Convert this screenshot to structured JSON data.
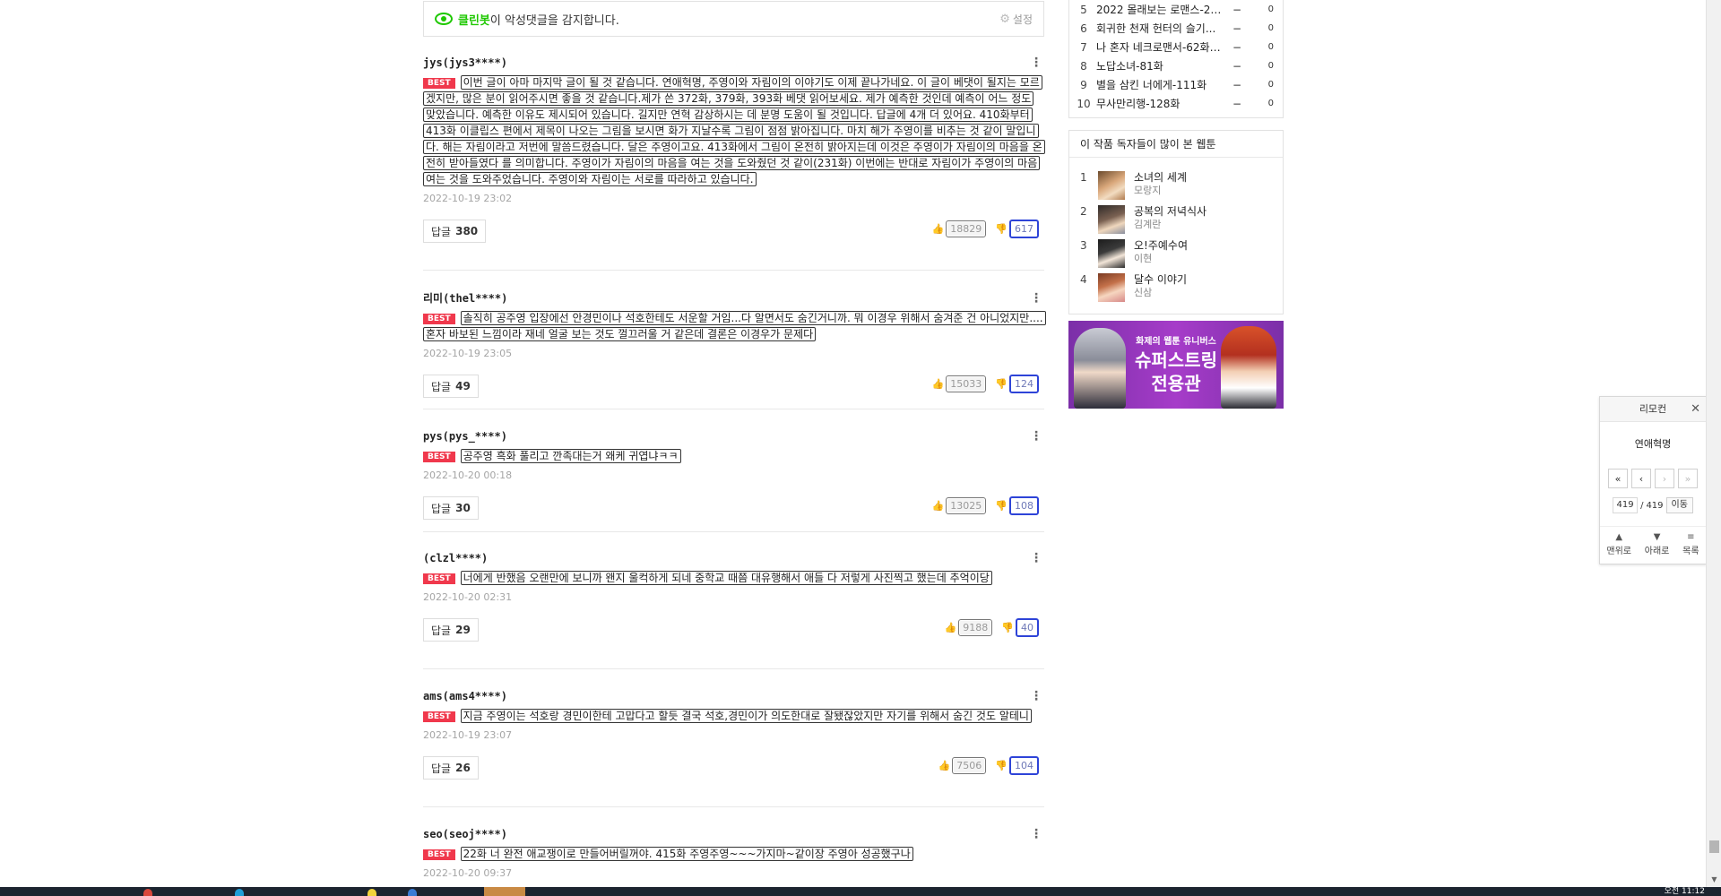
{
  "cleanbot": {
    "brand": "클린봇",
    "message": "이 악성댓글을 감지합니다.",
    "settings_label": "설정"
  },
  "comments": [
    {
      "user": "jys(jys3****)",
      "best_label": "BEST",
      "text": "이번 글이 아마 마지막 글이 될 것 같습니다. 연애혁명, 주영이와 자림이의 이야기도 이제 끝나가네요. 이 글이 베댓이 될지는 모르겠지만, 많은 분이 읽어주시면 좋을 것 같습니다.제가 쓴 372화, 379화, 393화 베댓 읽어보세요. 제가 예측한 것인데 예측이 어느 정도 맞았습니다. 예측한 이유도 제시되어 있습니다. 길지만 연혁 감상하시는 데 분명 도움이 될 것입니다. 답글에 4개 더 있어요. 410화부터 413화 이클립스 편에서 제목이 나오는 그림을 보시면 화가 지날수록 그림이 점점 밝아집니다. 마치 해가 주영이를 비추는 것 같이 말입니다. 해는 자림이라고 저번에 말씀드렸습니다. 달은 주영이고요. 413화에서 그림이 온전히 밝아지는데 이것은 주영이가 자림이의 마음을 온전히 받아들였다 를 의미합니다. 주영이가 자림이의 마음을 여는 것을 도와줬던 것 같이(231화) 이번에는 반대로 자림이가 주영이의 마음 여는 것을 도와주었습니다. 주영이와 자림이는 서로를 따라하고 있습니다.",
      "date": "2022-10-19 23:02",
      "reply_label": "답글",
      "reply_count": "380",
      "likes": "18829",
      "dislikes": "617"
    },
    {
      "user": "리미(thel****)",
      "best_label": "BEST",
      "text": "솔직히 공주영 입장에선 안경민이나 석호한테도 서운할 거임...다 알면서도 숨긴거니까. 뭐 이경우 위해서 숨겨준 건 아니었지만.... 혼자 바보된 느낌이라 재네 얼굴 보는 것도 껄끄러울 거 같은데 결론은 이경우가 문제다",
      "date": "2022-10-19 23:05",
      "reply_label": "답글",
      "reply_count": "49",
      "likes": "15033",
      "dislikes": "124"
    },
    {
      "user": "pys(pys_****)",
      "best_label": "BEST",
      "text": "공주영 흑화 풀리고 깐족대는거 왜케 귀엽냐ㅋㅋ",
      "date": "2022-10-20 00:18",
      "reply_label": "답글",
      "reply_count": "30",
      "likes": "13025",
      "dislikes": "108"
    },
    {
      "user": "(clzl****)",
      "best_label": "BEST",
      "text": "너에게 반했음 오랜만에 보니까 왠지 울컥하게 되네 중학교 때쯤 대유행해서 애들 다 저렇게 사진찍고 했는데 추억이당",
      "date": "2022-10-20 02:31",
      "reply_label": "답글",
      "reply_count": "29",
      "likes": "9188",
      "dislikes": "40"
    },
    {
      "user": "ams(ams4****)",
      "best_label": "BEST",
      "text": "지금 주영이는 석호랑 경민이한테 고맙다고 할듯 결국 석호,경민이가 의도한대로 잘됐잖았지만 자기를 위해서 숨긴 것도 알테니",
      "date": "2022-10-19 23:07",
      "reply_label": "답글",
      "reply_count": "26",
      "likes": "7506",
      "dislikes": "104"
    },
    {
      "user": "seo(seoj****)",
      "best_label": "BEST",
      "text": "22화 너 완전 애교쟁이로 만들어버릴꺼야. 415화 주영주영~~~가지마~같이장 주영아 성공했구나",
      "date": "2022-10-20 09:37",
      "reply_label": "답글",
      "reply_count": "",
      "likes": "",
      "dislikes": ""
    }
  ],
  "rank_list": [
    {
      "num": "5",
      "title": "2022 몰래보는 로맨스-21...",
      "trend": "−",
      "change": "0"
    },
    {
      "num": "6",
      "title": "회귀한 천재 헌터의 슬기...",
      "trend": "−",
      "change": "0"
    },
    {
      "num": "7",
      "title": "나 혼자 네크로맨서-62화 :...",
      "trend": "−",
      "change": "0"
    },
    {
      "num": "8",
      "title": "노답소녀-81화",
      "trend": "−",
      "change": "0"
    },
    {
      "num": "9",
      "title": "별을 삼킨 너에게-111화",
      "trend": "−",
      "change": "0"
    },
    {
      "num": "10",
      "title": "무사만리행-128화",
      "trend": "−",
      "change": "0"
    }
  ],
  "reco": {
    "heading": "이 작품 독자들이 많이 본 웹툰",
    "items": [
      {
        "num": "1",
        "title": "소녀의 세계",
        "author": "모랑지"
      },
      {
        "num": "2",
        "title": "공복의 저녁식사",
        "author": "김계란"
      },
      {
        "num": "3",
        "title": "오!주예수여",
        "author": "이현"
      },
      {
        "num": "4",
        "title": "달수 이야기",
        "author": "신삼"
      }
    ]
  },
  "banner": {
    "line1": "화제의 웹툰 유니버스",
    "line2": "슈퍼스트링",
    "line3": "전용관"
  },
  "remote": {
    "title": "리모컨",
    "work_title": "연애혁명",
    "current_page": "419",
    "separator": "/",
    "total_pages": "419",
    "go_label": "이동",
    "top_label": "맨위로",
    "down_label": "아래로",
    "list_label": "목록"
  },
  "taskbar": {
    "clock": "오전 11:12"
  }
}
